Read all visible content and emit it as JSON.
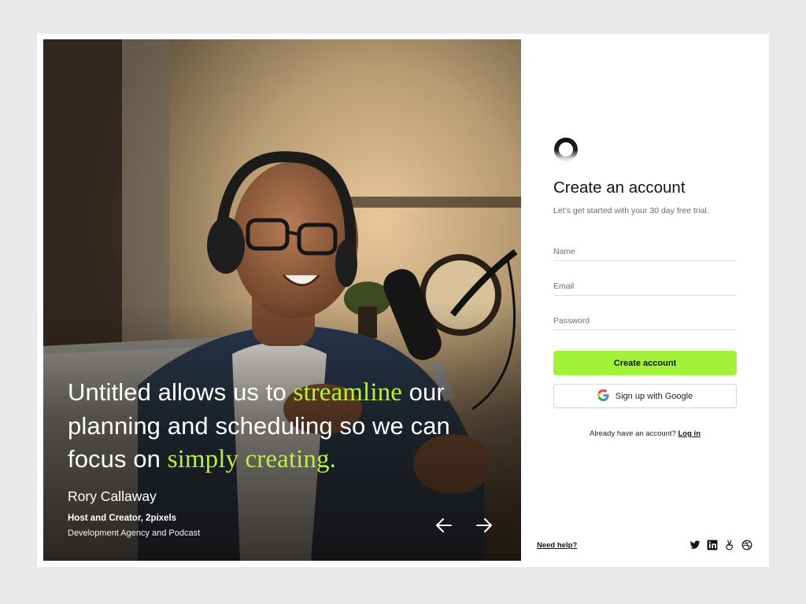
{
  "hero": {
    "quote_parts": [
      "Untitled allows us to ",
      "streamline",
      " our planning and scheduling so we can focus on ",
      "simply creating."
    ],
    "author_name": "Rory Callaway",
    "author_role": "Host and Creator, 2pixels",
    "author_org": "Development Agency and Podcast",
    "prev_icon": "arrow-left-icon",
    "next_icon": "arrow-right-icon",
    "highlight_color": "#b7f13a"
  },
  "form": {
    "logo_icon": "ring-logo-icon",
    "title": "Create an account",
    "subtitle": "Let’s get started with your 30 day free trial.",
    "fields": {
      "name": {
        "placeholder": "Name",
        "value": ""
      },
      "email": {
        "placeholder": "Email",
        "value": ""
      },
      "password": {
        "placeholder": "Password",
        "value": ""
      }
    },
    "primary_button": "Create account",
    "google_button": "Sign up with Google",
    "google_icon": "google-icon",
    "login_prompt": "Already have an account?",
    "login_link": "Log in",
    "accent_color": "#a3f23a"
  },
  "footer": {
    "help_link": "Need help?",
    "socials": [
      "twitter-icon",
      "linkedin-icon",
      "angellist-icon",
      "dribbble-icon"
    ]
  }
}
